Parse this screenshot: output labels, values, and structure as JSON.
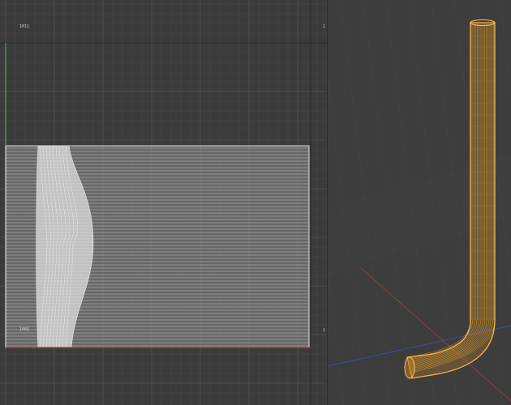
{
  "uv_editor": {
    "top_label": "1011",
    "side_mark_top": "1",
    "left_axis_label": "",
    "bottom_label": "1001",
    "side_mark_bottom": "1",
    "axis_colors": {
      "v": "#35a53b",
      "u": "#c8383d"
    },
    "mesh_color": "#e6e6e6",
    "island_fill": "#c8c8c8"
  },
  "viewport_3d": {
    "center_label": "",
    "object_color": "#f5a623",
    "object_outline": "#ffb64a",
    "axis_colors": {
      "x": "#b43a3a",
      "y": "#3a54b4"
    }
  }
}
